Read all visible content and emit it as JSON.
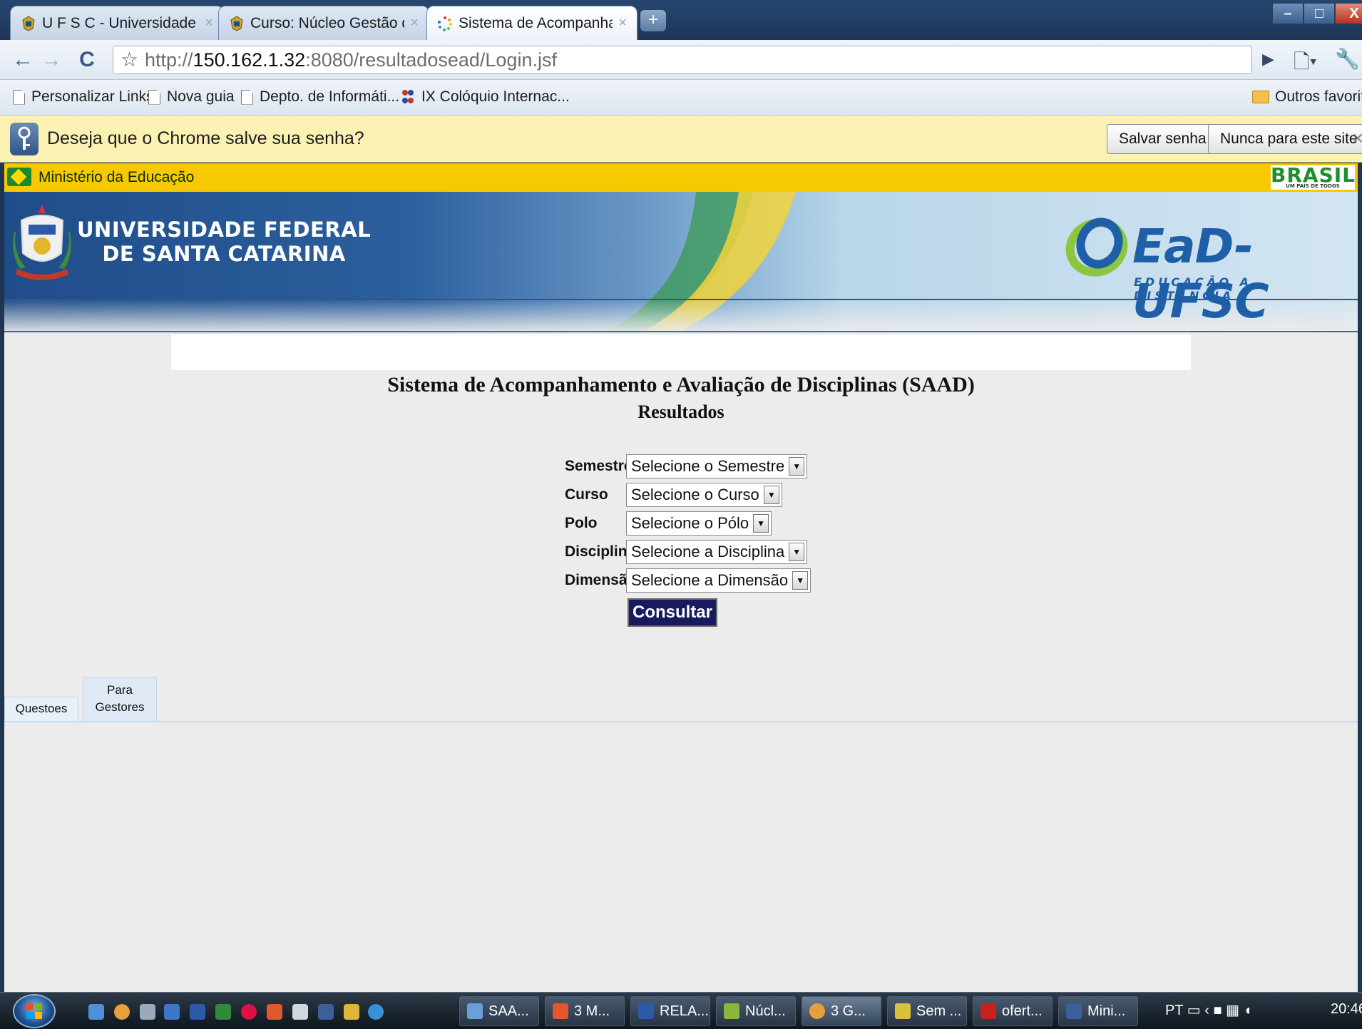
{
  "browser": {
    "tabs": [
      {
        "label": "U F S C - Universidade Fe...",
        "active": false
      },
      {
        "label": "Curso: Núcleo Gestão de ...",
        "active": false
      },
      {
        "label": "Sistema de Acompanha...",
        "active": true
      }
    ],
    "url_prefix": "http://",
    "url_host": "150.162.1.32",
    "url_rest": ":8080/resultadosead/Login.jsf",
    "bookmarks": [
      {
        "label": "Personalizar Links"
      },
      {
        "label": "Nova guia"
      },
      {
        "label": "Depto. de Informáti..."
      },
      {
        "label": "IX Colóquio Internac..."
      }
    ],
    "other_bookmarks": "Outros favoritos",
    "infobar": {
      "text": "Deseja que o Chrome salve sua senha?",
      "save_label": "Salvar senha",
      "never_label": "Nunca para este site"
    }
  },
  "govbar": {
    "label": "Ministério da Educação",
    "brasil_text": "BRASIL",
    "brasil_motto": "UM PAÍS DE TODOS"
  },
  "banner": {
    "university_line1": "UNIVERSIDADE FEDERAL",
    "university_line2": "DE SANTA CATARINA",
    "ead_title": "EaD-UFSC",
    "ead_subtitle": "EDUCAÇÃO A DISTÂNCIA"
  },
  "page": {
    "title": "Sistema de Acompanhamento e Avaliação de Disciplinas (SAAD)",
    "subtitle": "Resultados",
    "form": [
      {
        "label": "Semestre",
        "value": "Selecione o Semestre"
      },
      {
        "label": "Curso",
        "value": "Selecione o Curso"
      },
      {
        "label": "Polo",
        "value": "Selecione o Pólo"
      },
      {
        "label": "Disciplina",
        "value": "Selecione a Disciplina"
      },
      {
        "label": "Dimensão",
        "value": "Selecione a Dimensão"
      }
    ],
    "submit_label": "Consultar",
    "tabs": [
      {
        "label": "Questoes"
      },
      {
        "label_line1": "Para",
        "label_line2": "Gestores"
      }
    ]
  },
  "taskbar": {
    "buttons": [
      {
        "label": "SAA..."
      },
      {
        "label": "3 M..."
      },
      {
        "label": "RELA..."
      },
      {
        "label": "Núcl..."
      },
      {
        "label": "3 G..."
      },
      {
        "label": "Sem ..."
      },
      {
        "label": "ofert..."
      },
      {
        "label": "Mini..."
      }
    ],
    "language": "PT",
    "clock": "20:46"
  }
}
